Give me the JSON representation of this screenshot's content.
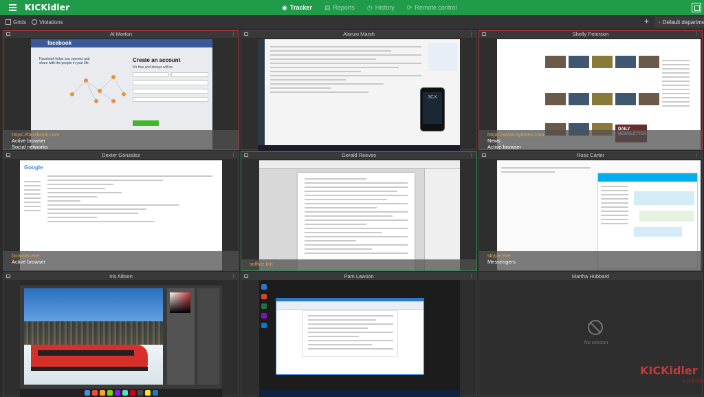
{
  "header": {
    "logo": "KICKidler",
    "nav": [
      {
        "label": "Tracker",
        "icon": "eye-icon",
        "active": true
      },
      {
        "label": "Reports",
        "icon": "chart-icon",
        "active": false
      },
      {
        "label": "History",
        "icon": "history-icon",
        "active": false
      },
      {
        "label": "Remote control",
        "icon": "remote-icon",
        "active": false
      }
    ]
  },
  "toolbar": {
    "grids_label": "Grids",
    "violations_label": "Violations",
    "add_label": "+",
    "department_label": "Default department"
  },
  "tiles": [
    {
      "name": "Al Morton",
      "app": "https://facebook.com",
      "category": "Active browser",
      "subcategory": "Social networks"
    },
    {
      "name": "Alonzo Marsh",
      "app": "",
      "category": "",
      "subcategory": ""
    },
    {
      "name": "Shelly Peterson",
      "app": "https://www.nytimes.com",
      "category": "News",
      "subcategory": "Active browser"
    },
    {
      "name": "Dexter Gonzalez",
      "app": "browser.exe",
      "category": "Active browser",
      "subcategory": ""
    },
    {
      "name": "Gerald Reeves",
      "app": "soffice.bin",
      "category": "",
      "subcategory": ""
    },
    {
      "name": "Ross Carter",
      "app": "skype.exe",
      "category": "Messengers",
      "subcategory": ""
    },
    {
      "name": "Iris Allison",
      "app": "",
      "category": "",
      "subcategory": ""
    },
    {
      "name": "Pam Lawson",
      "app": "",
      "category": "",
      "subcategory": ""
    },
    {
      "name": "Martha Hubbard",
      "app": "",
      "category": "",
      "subcategory": "",
      "status": "No session"
    }
  ],
  "screens": {
    "facebook": {
      "brand": "facebook",
      "tagline": "Facebook helps you connect and share with the people in your life.",
      "create_title": "Create an account",
      "create_sub": "It's free and always will be."
    },
    "alonzo": {
      "phone_text": "3CX"
    },
    "shelly": {
      "newsletter": "DAILY NEWSLETTER"
    },
    "dexter": {
      "logo": "Google"
    }
  },
  "watermark": {
    "brand": "KICKidler",
    "sub": "kickidler"
  },
  "colors": {
    "accent": "#1f9b4a",
    "violation": "#b33a3a",
    "active": "#2e8a4e",
    "app_text": "#e5a63a"
  }
}
